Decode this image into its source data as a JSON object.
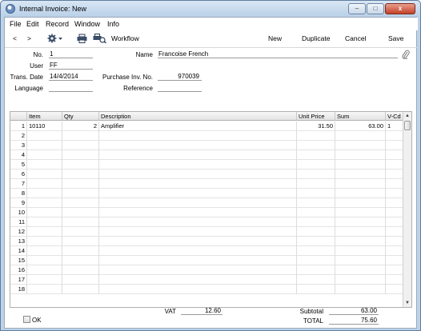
{
  "window": {
    "title": "Internal Invoice: New",
    "controls": {
      "minimize": "–",
      "maximize": "□",
      "close": "x"
    }
  },
  "menu": [
    "File",
    "Edit",
    "Record",
    "Window",
    "Info"
  ],
  "toolbar": {
    "back": "<",
    "forward": ">",
    "workflow": "Workflow",
    "new": "New",
    "duplicate": "Duplicate",
    "cancel": "Cancel",
    "save": "Save"
  },
  "header": {
    "no_label": "No.",
    "no_value": "1",
    "name_label": "Name",
    "name_value": "Francoise French",
    "user_label": "User",
    "user_value": "FF",
    "trans_date_label": "Trans. Date",
    "trans_date_value": "14/4/2014",
    "purchase_inv_label": "Purchase Inv. No.",
    "purchase_inv_value": "970039",
    "language_label": "Language",
    "language_value": "",
    "reference_label": "Reference",
    "reference_value": ""
  },
  "grid": {
    "columns": [
      "Item",
      "Qty",
      "Description",
      "Unit Price",
      "Sum",
      "V-Cd"
    ],
    "rows": [
      {
        "n": "1",
        "item": "10110",
        "qty": "2",
        "description": "Amplifier",
        "unit_price": "31.50",
        "sum": "63.00",
        "vcd": "1"
      },
      {
        "n": "2",
        "item": "",
        "qty": "",
        "description": "",
        "unit_price": "",
        "sum": "",
        "vcd": ""
      },
      {
        "n": "3",
        "item": "",
        "qty": "",
        "description": "",
        "unit_price": "",
        "sum": "",
        "vcd": ""
      },
      {
        "n": "4",
        "item": "",
        "qty": "",
        "description": "",
        "unit_price": "",
        "sum": "",
        "vcd": ""
      },
      {
        "n": "5",
        "item": "",
        "qty": "",
        "description": "",
        "unit_price": "",
        "sum": "",
        "vcd": ""
      },
      {
        "n": "6",
        "item": "",
        "qty": "",
        "description": "",
        "unit_price": "",
        "sum": "",
        "vcd": ""
      },
      {
        "n": "7",
        "item": "",
        "qty": "",
        "description": "",
        "unit_price": "",
        "sum": "",
        "vcd": ""
      },
      {
        "n": "8",
        "item": "",
        "qty": "",
        "description": "",
        "unit_price": "",
        "sum": "",
        "vcd": ""
      },
      {
        "n": "9",
        "item": "",
        "qty": "",
        "description": "",
        "unit_price": "",
        "sum": "",
        "vcd": ""
      },
      {
        "n": "10",
        "item": "",
        "qty": "",
        "description": "",
        "unit_price": "",
        "sum": "",
        "vcd": ""
      },
      {
        "n": "11",
        "item": "",
        "qty": "",
        "description": "",
        "unit_price": "",
        "sum": "",
        "vcd": ""
      },
      {
        "n": "12",
        "item": "",
        "qty": "",
        "description": "",
        "unit_price": "",
        "sum": "",
        "vcd": ""
      },
      {
        "n": "13",
        "item": "",
        "qty": "",
        "description": "",
        "unit_price": "",
        "sum": "",
        "vcd": ""
      },
      {
        "n": "14",
        "item": "",
        "qty": "",
        "description": "",
        "unit_price": "",
        "sum": "",
        "vcd": ""
      },
      {
        "n": "15",
        "item": "",
        "qty": "",
        "description": "",
        "unit_price": "",
        "sum": "",
        "vcd": ""
      },
      {
        "n": "16",
        "item": "",
        "qty": "",
        "description": "",
        "unit_price": "",
        "sum": "",
        "vcd": ""
      },
      {
        "n": "17",
        "item": "",
        "qty": "",
        "description": "",
        "unit_price": "",
        "sum": "",
        "vcd": ""
      },
      {
        "n": "18",
        "item": "",
        "qty": "",
        "description": "",
        "unit_price": "",
        "sum": "",
        "vcd": ""
      }
    ]
  },
  "footer": {
    "ok_label": "OK",
    "vat_label": "VAT",
    "vat_value": "12.60",
    "subtotal_label": "Subtotal",
    "subtotal_value": "63.00",
    "total_label": "TOTAL",
    "total_value": "75.60"
  },
  "colors": {
    "window_frame": "#bcd3ea",
    "close_button": "#c34127"
  },
  "icons": [
    "app-icon",
    "gear-icon",
    "printer-icon",
    "print-preview-icon",
    "paperclip-icon"
  ]
}
